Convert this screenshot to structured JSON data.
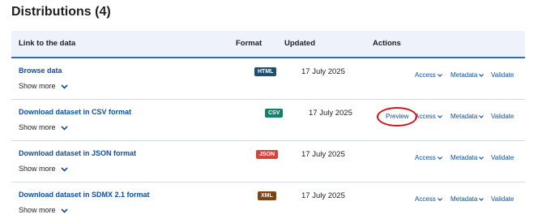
{
  "title": "Distributions (4)",
  "columns": {
    "link": "Link to the data",
    "format": "Format",
    "updated": "Updated",
    "actions": "Actions"
  },
  "rows": [
    {
      "link": "Browse data",
      "show_more": "Show more",
      "format": "HTML",
      "format_color": "#1f4e6e",
      "updated": "17 July 2025"
    },
    {
      "link": "Download dataset in CSV format",
      "show_more": "Show more",
      "format": "CSV",
      "format_color": "#13806a",
      "updated": "17 July 2025",
      "preview": "Preview"
    },
    {
      "link": "Download dataset in JSON format",
      "show_more": "Show more",
      "format": "JSON",
      "format_color": "#d6433a",
      "updated": "17 July 2025"
    },
    {
      "link": "Download dataset in SDMX 2.1 format",
      "show_more": "Show more",
      "format": "XML",
      "format_color": "#7a4414",
      "updated": "17 July 2025"
    }
  ],
  "actions": {
    "access": "Access",
    "metadata": "Metadata",
    "validate": "Validate"
  },
  "colors": {
    "link": "#0c4ea6",
    "header_bg": "#eef3fb",
    "header_border": "#2d6cc0",
    "highlight": "#d0141a"
  },
  "icons": {
    "dropdown": "chevron-down-icon"
  }
}
